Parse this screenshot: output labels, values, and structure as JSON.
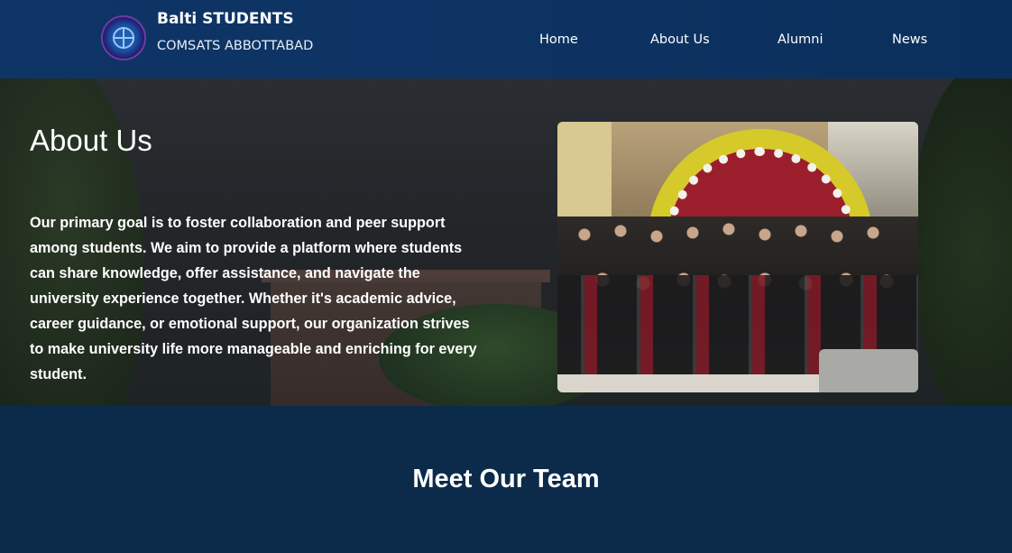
{
  "header": {
    "brand_title": "Balti STUDENTS",
    "brand_subtitle": "COMSATS ABBOTTABAD",
    "logo_icon": "university-seal-icon",
    "nav": [
      {
        "label": "Home"
      },
      {
        "label": "About Us"
      },
      {
        "label": "Alumni"
      },
      {
        "label": "News"
      }
    ]
  },
  "about": {
    "title": "About Us",
    "body": "Our primary goal is to foster collaboration and peer support among students. We aim to provide a platform where students can share knowledge, offer assistance, and navigate the university experience together. Whether it's academic advice, career guidance, or emotional support, our organization strives to make university life more manageable and enriching for every student."
  },
  "team": {
    "title": "Meet Our Team"
  },
  "colors": {
    "header_bg": "#0e3566",
    "section_bg": "#0c2a4a",
    "text": "#ffffff"
  }
}
